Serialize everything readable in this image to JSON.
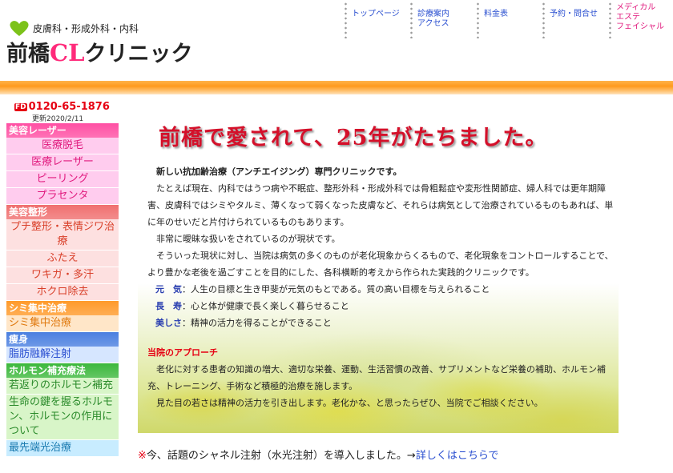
{
  "header": {
    "subtitle": "皮膚科・形成外科・内科",
    "title_prefix": "前橋",
    "title_cl": "CL",
    "title_suffix": "クリニック"
  },
  "nav": [
    {
      "label": "トップページ"
    },
    {
      "label": "診療案内\nアクセス"
    },
    {
      "label": "料金表"
    },
    {
      "label": "予約・問合せ"
    },
    {
      "label": "メディカル\nエステ\nフェイシャル"
    }
  ],
  "sidebar": {
    "phone_badge": "FD",
    "phone": "0120-65-1876",
    "updated": "更新2020/2/11",
    "menu": [
      {
        "type": "cat",
        "label": "美容レーザー",
        "color": "#ff4fa3"
      },
      {
        "type": "item",
        "label": "医療脱毛",
        "bg": "#ffccee",
        "fg": "#e0197d"
      },
      {
        "type": "item",
        "label": "医療レーザー",
        "bg": "#ffccee",
        "fg": "#e0197d"
      },
      {
        "type": "item",
        "label": "ピーリング",
        "bg": "#ffccee",
        "fg": "#e0197d"
      },
      {
        "type": "item",
        "label": "プラセンタ",
        "bg": "#ffccee",
        "fg": "#e0197d"
      },
      {
        "type": "cat",
        "label": "美容整形",
        "color": "#f06f6f"
      },
      {
        "type": "item",
        "label": "プチ整形・表情ジワ治療",
        "bg": "#fde0e0",
        "fg": "#d9402a"
      },
      {
        "type": "item",
        "label": "ふたえ",
        "bg": "#fde0e0",
        "fg": "#d9402a"
      },
      {
        "type": "item",
        "label": "ワキガ・多汗",
        "bg": "#fde0e0",
        "fg": "#d9402a"
      },
      {
        "type": "item",
        "label": "ホクロ除去",
        "bg": "#fde0e0",
        "fg": "#d9402a"
      },
      {
        "type": "cat",
        "label": "シミ集中治療",
        "color": "#ff9a2a"
      },
      {
        "type": "item",
        "label": "シミ集中治療",
        "bg": "#ffe6c8",
        "fg": "#e07a10",
        "left": true
      },
      {
        "type": "cat",
        "label": "痩身",
        "color": "#4a7fe0"
      },
      {
        "type": "item",
        "label": "脂肪融解注射",
        "bg": "#d6e6ff",
        "fg": "#2a4fd0",
        "left": true
      },
      {
        "type": "cat",
        "label": "ホルモン補充療法",
        "color": "#3cb83c"
      },
      {
        "type": "item",
        "label": "若返りのホルモン補充",
        "bg": "#d8f5c8",
        "fg": "#2a8a2a",
        "left": true
      },
      {
        "type": "item",
        "label": "生命の鍵を握るホルモン、ホルモンの作用について",
        "bg": "#d8f5c8",
        "fg": "#2a8a2a",
        "left": true
      },
      {
        "type": "item",
        "label": "最先端光治療",
        "bg": "#c8ecff",
        "fg": "#1a7ab0",
        "left": true
      }
    ]
  },
  "main": {
    "headline": "前橋で愛されて、25年がたちました。",
    "lead": "新しい抗加齢治療（アンチエイジング）専門クリニックです。",
    "para1": "たとえば現在、内科ではうつ病や不眠症、整形外科・形成外科では骨粗鬆症や変形性関節症、婦人科では更年期障害、皮膚科ではシミやタルミ、薄くなって弱くなった皮膚など、それらは病気として治療されているものもあれば、単に年のせいだと片付けられているものもあります。",
    "para2": "非常に曖昧な扱いをされているのが現状です。",
    "para3": "そういった現状に対し、当院は病気の多くのものが老化現象からくるもので、老化現象をコントロールすることで、より豊かな老後を過ごすことを目的にした、各科横断的考えから作られた実践的クリニックです。",
    "keywords": [
      {
        "term": "元　気",
        "desc": "：人生の目標と生き甲斐が元気のもとである。質の高い目標を与えられること"
      },
      {
        "term": "長　寿",
        "desc": "：心と体が健康で長く楽しく暮らせること"
      },
      {
        "term": "美しさ",
        "desc": "：精神の活力を得ることができること"
      }
    ],
    "approach_title": "当院のアプローチ",
    "approach1": "老化に対する患者の知識の増大、適切な栄養、運動、生活習慣の改善、サプリメントなど栄養の補助、ホルモン補充、トレーニング、手術など積極的治療を施します。",
    "approach2": "見た目の若さは精神の活力を引き出します。老化かな、と思ったらぜひ、当院でご相談ください。",
    "notice_mark": "※",
    "notice_text": "今、話題のシャネル注射（水光注射）を導入しました。→",
    "notice_link": "詳しくはこちらで"
  }
}
